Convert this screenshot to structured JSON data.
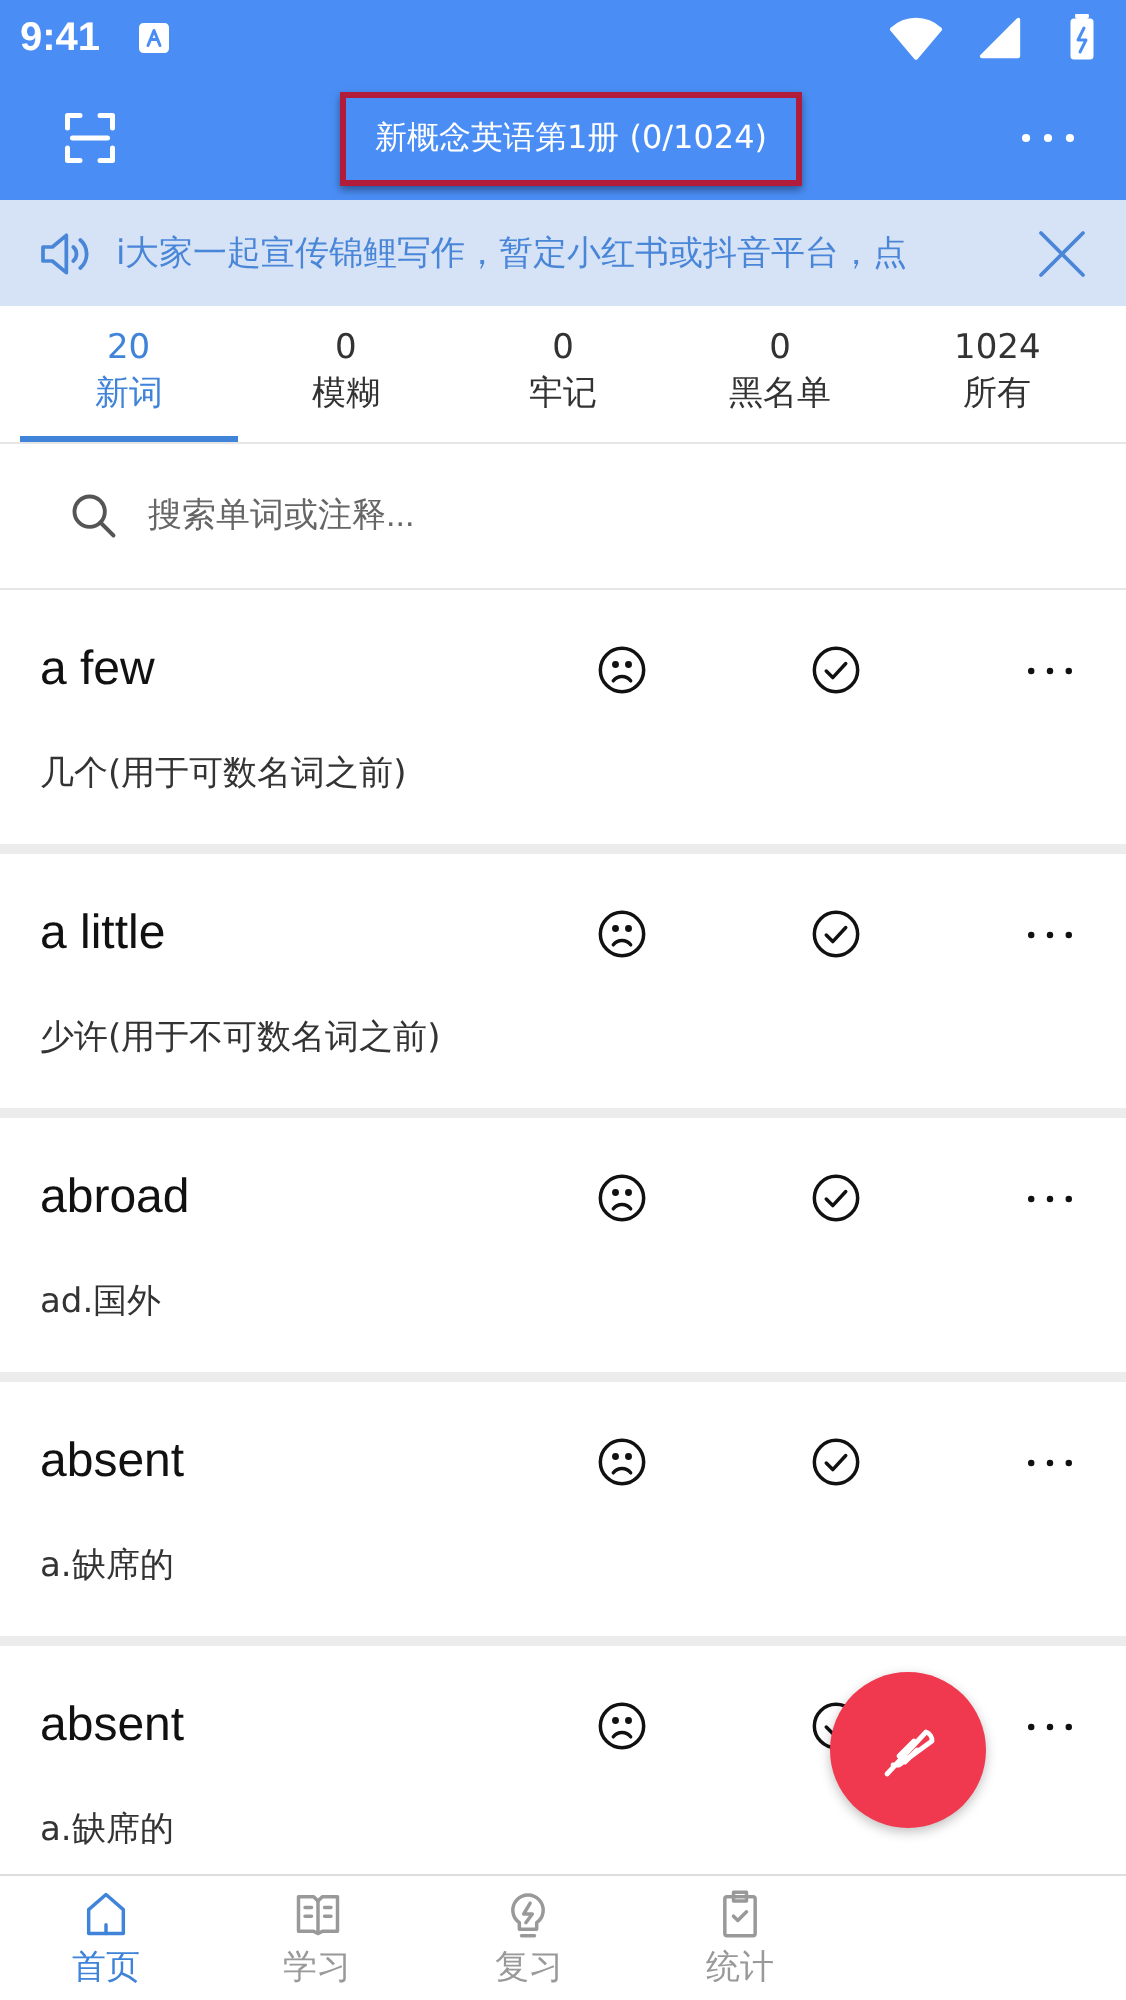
{
  "status_bar": {
    "time": "9:41"
  },
  "app_bar": {
    "title": "新概念英语第1册 (0/1024)",
    "title_highlighted": true
  },
  "notice": {
    "text": "i大家一起宣传锦鲤写作，暂定小红书或抖音平台，点"
  },
  "tabs": [
    {
      "count": "20",
      "label": "新词",
      "selected": true
    },
    {
      "count": "0",
      "label": "模糊",
      "selected": false
    },
    {
      "count": "0",
      "label": "牢记",
      "selected": false
    },
    {
      "count": "0",
      "label": "黑名单",
      "selected": false
    },
    {
      "count": "1024",
      "label": "所有",
      "selected": false
    }
  ],
  "search": {
    "placeholder": "搜索单词或注释..."
  },
  "words": [
    {
      "word": "a few",
      "meaning": "几个(用于可数名词之前)"
    },
    {
      "word": "a little",
      "meaning": "少许(用于不可数名词之前)"
    },
    {
      "word": "abroad",
      "meaning": "ad.国外"
    },
    {
      "word": "absent",
      "meaning": "a.缺席的"
    },
    {
      "word": "absent",
      "meaning": "a.缺席的"
    }
  ],
  "bottom_nav": [
    {
      "label": "首页",
      "kind": "home",
      "selected": true
    },
    {
      "label": "学习",
      "kind": "book",
      "selected": false
    },
    {
      "label": "复习",
      "kind": "bulb",
      "selected": false
    },
    {
      "label": "统计",
      "kind": "clipboard",
      "selected": false
    }
  ]
}
